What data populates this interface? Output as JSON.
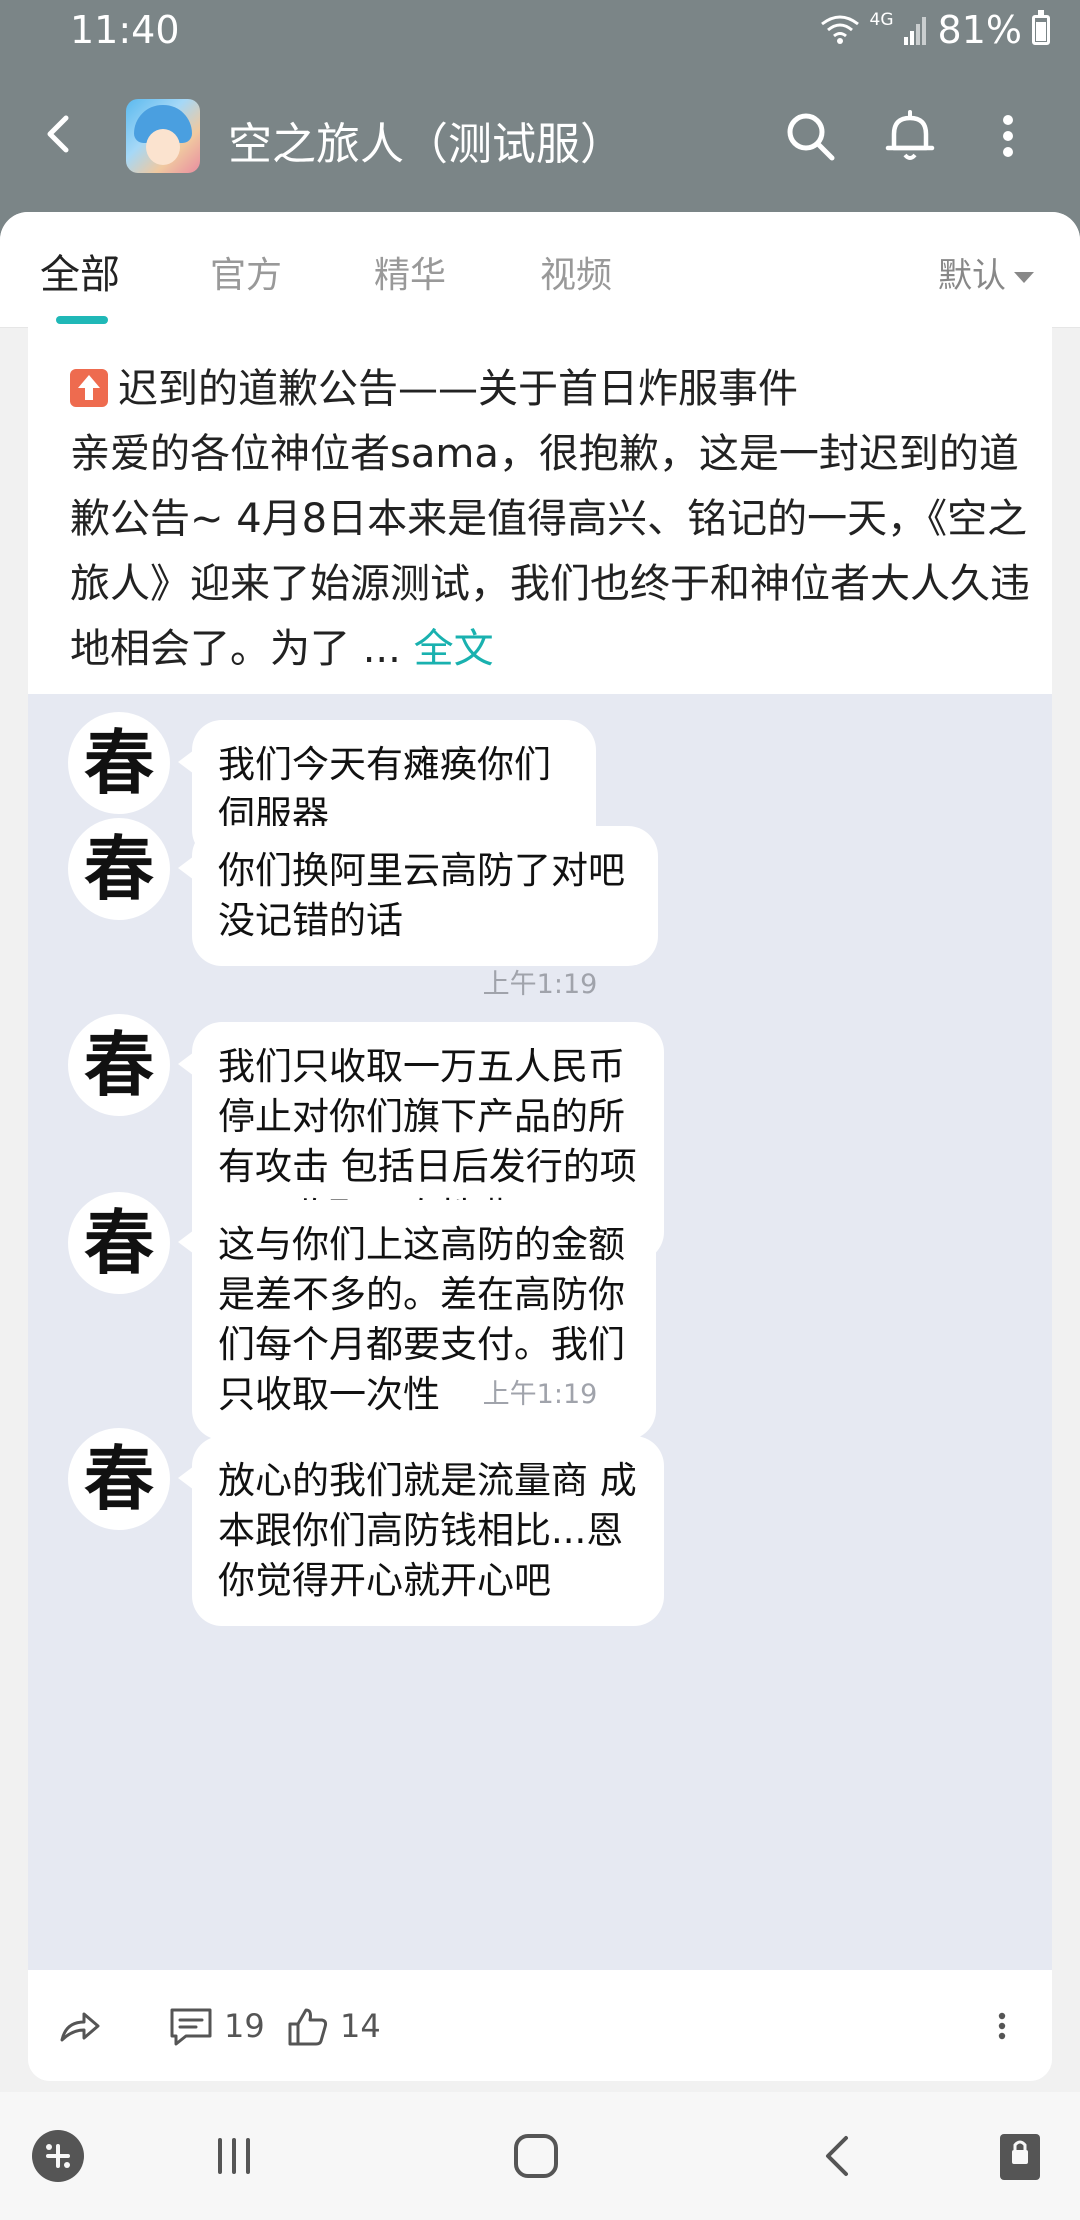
{
  "status": {
    "time": "11:40",
    "network": "4G",
    "battery": "81%",
    "battery_level": 0.81
  },
  "appbar": {
    "title": "空之旅人（测试服）"
  },
  "tabs": [
    {
      "label": "全部",
      "active": true
    },
    {
      "label": "官方"
    },
    {
      "label": "精华"
    },
    {
      "label": "视频"
    }
  ],
  "sort": {
    "label": "默认"
  },
  "post": {
    "title": "迟到的道歉公告——关于首日炸服事件",
    "body": "亲爱的各位神位者sama，很抱歉，这是一封迟到的道歉公告~ 4月8日本来是值得高兴、铭记的一天，《空之旅人》迎来了始源测试，我们也终于和神位者大人久违地相会了。为了 ...",
    "more_label": "全文"
  },
  "chat": {
    "avatar_char": "春",
    "messages": [
      {
        "text": "我们今天有瘫痪你们伺服器"
      },
      {
        "text": "你们换阿里云高防了对吧没记错的话"
      },
      {
        "text": "我们只收取一万五人民币停止对你们旗下产品的所有攻击 包括日后发行的项目只收取一次性费用"
      },
      {
        "text": "这与你们上这高防的金额是差不多的。差在高防你们每个月都要支付。我们只收取一次性"
      },
      {
        "text": "放心的我们就是流量商 成本跟你们高防钱相比...恩你觉得开心就开心吧"
      }
    ],
    "timestamps": [
      "上午1:19",
      "上午1:19"
    ]
  },
  "actions": {
    "comments": "19",
    "likes": "14"
  }
}
